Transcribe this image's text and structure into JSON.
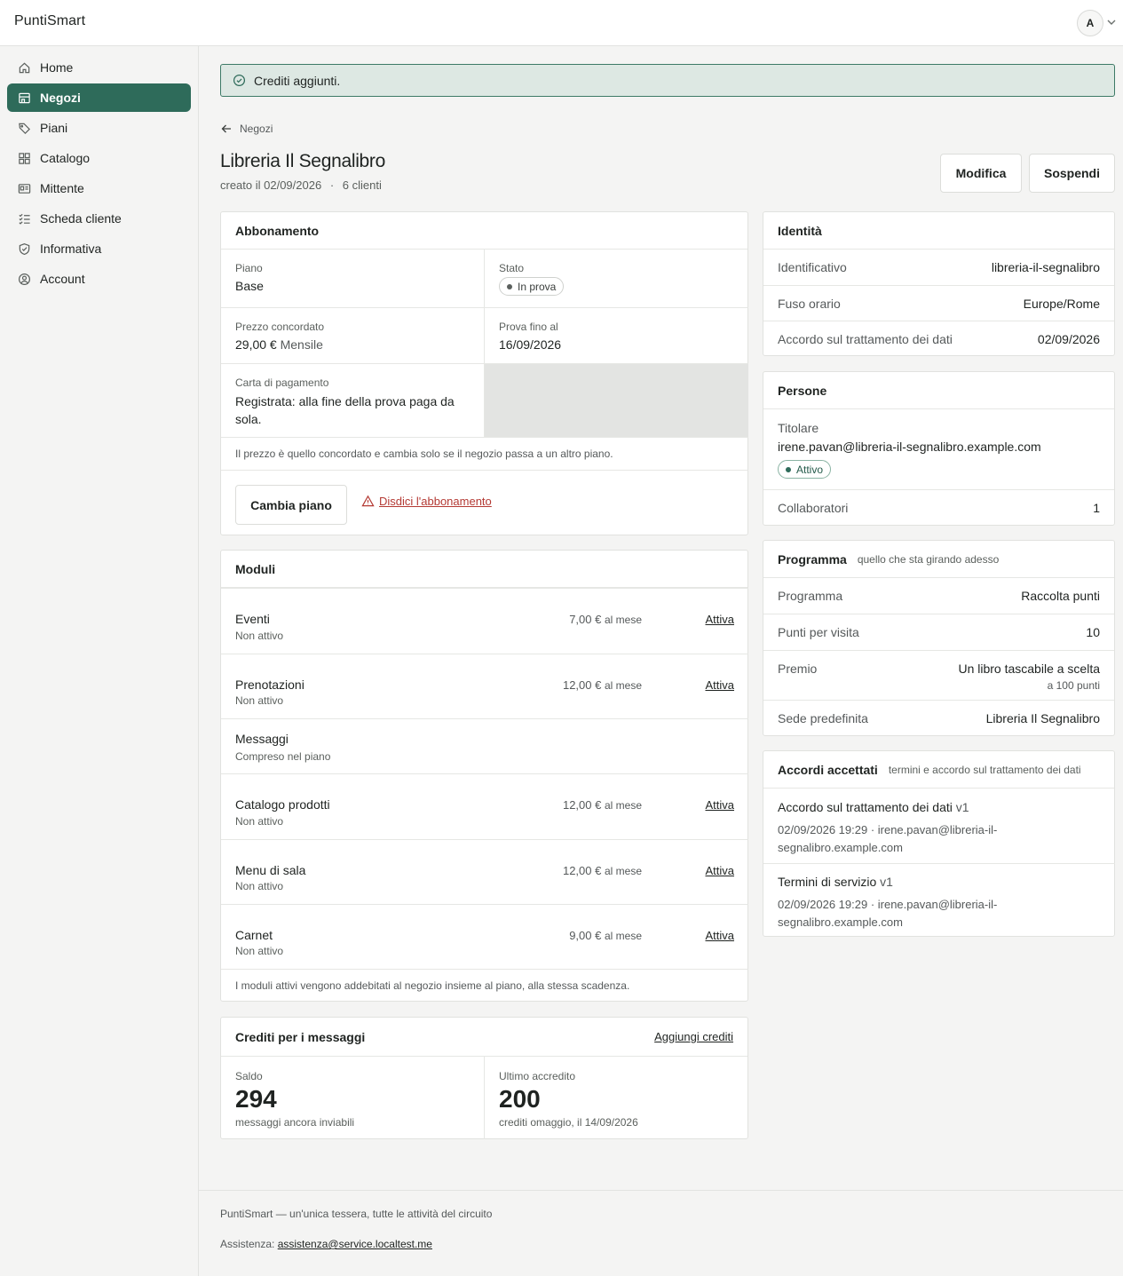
{
  "app": {
    "brand": "PuntiSmart",
    "avatar_initial": "A"
  },
  "sidebar": {
    "items": [
      {
        "label": "Home",
        "icon": "home-icon"
      },
      {
        "label": "Negozi",
        "icon": "store-icon",
        "active": true
      },
      {
        "label": "Piani",
        "icon": "tag-icon"
      },
      {
        "label": "Catalogo",
        "icon": "grid-icon"
      },
      {
        "label": "Mittente",
        "icon": "id-card-icon"
      },
      {
        "label": "Scheda cliente",
        "icon": "checklist-icon"
      },
      {
        "label": "Informativa",
        "icon": "shield-icon"
      },
      {
        "label": "Account",
        "icon": "user-circle-icon"
      }
    ]
  },
  "alert": {
    "text": "Crediti aggiunti."
  },
  "header": {
    "back_label": "Negozi",
    "title": "Libreria Il Segnalibro",
    "created": "creato il 02/09/2026",
    "separator": "·",
    "clients": "6 clienti",
    "edit_label": "Modifica",
    "suspend_label": "Sospendi"
  },
  "subscription": {
    "title": "Abbonamento",
    "plan_label": "Piano",
    "plan_value": "Base",
    "status_label": "Stato",
    "status_value": "In prova",
    "price_label": "Prezzo concordato",
    "price_value": "29,00 €",
    "price_period": "Mensile",
    "trial_label": "Prova fino al",
    "trial_value": "16/09/2026",
    "card_label": "Carta di pagamento",
    "card_value": "Registrata: alla fine della prova paga da sola.",
    "note": "Il prezzo è quello concordato e cambia solo se il negozio passa a un altro piano.",
    "change_label": "Cambia piano",
    "cancel_label": "Disdici l'abbonamento"
  },
  "modules": {
    "title": "Moduli",
    "unit": "al mese",
    "items": [
      {
        "name": "Eventi",
        "status": "Non attivo",
        "price": "7,00 €",
        "action": "Attiva"
      },
      {
        "name": "Prenotazioni",
        "status": "Non attivo",
        "price": "12,00 €",
        "action": "Attiva"
      },
      {
        "name": "Messaggi",
        "status": "Compreso nel piano"
      },
      {
        "name": "Catalogo prodotti",
        "status": "Non attivo",
        "price": "12,00 €",
        "action": "Attiva"
      },
      {
        "name": "Menu di sala",
        "status": "Non attivo",
        "price": "12,00 €",
        "action": "Attiva"
      },
      {
        "name": "Carnet",
        "status": "Non attivo",
        "price": "9,00 €",
        "action": "Attiva"
      }
    ],
    "note": "I moduli attivi vengono addebitati al negozio insieme al piano, alla stessa scadenza."
  },
  "credits": {
    "title": "Crediti per i messaggi",
    "add_label": "Aggiungi crediti",
    "balance_label": "Saldo",
    "balance_value": "294",
    "balance_note": "messaggi ancora inviabili",
    "last_label": "Ultimo accredito",
    "last_value": "200",
    "last_note": "crediti omaggio, il 14/09/2026"
  },
  "identity": {
    "title": "Identità",
    "rows": [
      {
        "k": "Identificativo",
        "v": "libreria-il-segnalibro"
      },
      {
        "k": "Fuso orario",
        "v": "Europe/Rome"
      },
      {
        "k": "Accordo sul trattamento dei dati",
        "v": "02/09/2026"
      }
    ]
  },
  "people": {
    "title": "Persone",
    "owner_label": "Titolare",
    "owner_email": "irene.pavan@libreria-il-segnalibro.example.com",
    "owner_status": "Attivo",
    "collab_label": "Collaboratori",
    "collab_value": "1"
  },
  "program": {
    "title": "Programma",
    "note": "quello che sta girando adesso",
    "rows": [
      {
        "k": "Programma",
        "v": "Raccolta punti"
      },
      {
        "k": "Punti per visita",
        "v": "10"
      },
      {
        "k": "Premio",
        "v": "Un libro tascabile a scelta",
        "sub": "a 100 punti"
      },
      {
        "k": "Sede predefinita",
        "v": "Libreria Il Segnalibro"
      }
    ]
  },
  "agreements": {
    "title": "Accordi accettati",
    "note": "termini e accordo sul trattamento dei dati",
    "items": [
      {
        "name": "Accordo sul trattamento dei dati",
        "version": "v1",
        "line1": "02/09/2026 19:29 · irene.pavan@libreria-il-",
        "line2": "segnalibro.example.com"
      },
      {
        "name": "Termini di servizio",
        "version": "v1",
        "line1": "02/09/2026 19:29 · irene.pavan@libreria-il-",
        "line2": "segnalibro.example.com"
      }
    ]
  },
  "footer": {
    "tagline": "PuntiSmart — un'unica tessera, tutte le attività del circuito",
    "support_label": "Assistenza:",
    "support_email": "assistenza@service.localtest.me"
  }
}
